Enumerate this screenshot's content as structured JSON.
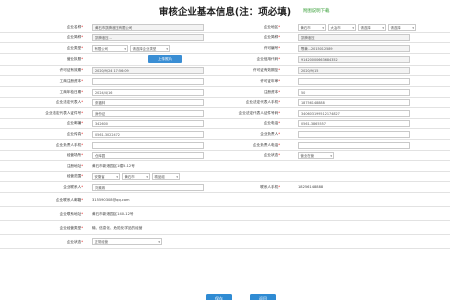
{
  "title": "审核企业基本信息(注：项必填)",
  "title_hint": "附图说明下载",
  "colors": {
    "accent": "#3a8ed4",
    "required": "#e02020",
    "hint": "#2f9a2f"
  },
  "rows": [
    {
      "left_label": "企业名称",
      "left_req": "*",
      "left_value": "黄石市凯腾液压有限公司",
      "right_label": "企业地区",
      "right_req": "*",
      "right_selects": [
        "黄石市",
        "大冶市",
        "请选择",
        "请选择"
      ]
    },
    {
      "left_label": "企业简称",
      "left_req": "*",
      "left_value": "凯腾液压...",
      "right_label": "企业简称",
      "right_req": "*",
      "right_value": "凯腾液压"
    },
    {
      "left_label": "企业类型",
      "left_req": "*",
      "left_selects": [
        "有限公司",
        "请选择企业类型"
      ],
      "right_label": "许可编号",
      "right_req": "*",
      "right_value": "鄂黄...2015012589"
    },
    {
      "left_label": "营业执照",
      "left_req": "*",
      "left_button": "上传照片",
      "right_label": "企业信用代码",
      "right_req": "*",
      "right_value": "91420000663684352"
    },
    {
      "left_label": "许可证有效期",
      "left_req": "*",
      "left_value": "2020/9/24 17:56:09",
      "right_label": "许可证有效期至",
      "right_req": "*",
      "right_value": "2020/9/15"
    },
    {
      "left_label": "工商注册资本",
      "left_req": "*",
      "left_value": "",
      "right_label": "许可证年审",
      "right_req": "*",
      "right_value": ""
    },
    {
      "left_label": "工商年检日期",
      "left_req": "*",
      "left_value": "2024/4/16",
      "right_label": "注册资本",
      "right_req": "*",
      "right_value": "50"
    },
    {
      "left_label": "企业法定代表人",
      "left_req": "*",
      "left_value": "张福林",
      "right_label": "企业法定代表人手机",
      "right_req": "*",
      "right_value": "18756148888"
    },
    {
      "left_label": "企业法定代表人证件号",
      "left_req": "*",
      "left_value": "身份证",
      "right_label": "企业法定代表人证件号码",
      "right_req": "*",
      "right_value": "340603199512174827"
    },
    {
      "left_label": "企业邮编",
      "left_req": "*",
      "left_value": "342600",
      "right_label": "企业电话",
      "right_req": "*",
      "right_value": "0561-3865557"
    },
    {
      "left_label": "企业传真",
      "left_req": "*",
      "left_value": "0561-3022472",
      "right_label": "企业负责人",
      "right_req": "*",
      "right_value": ""
    },
    {
      "left_label": "企业负责人手机",
      "left_req": "*",
      "left_value": "",
      "right_label": "企业负责人电话",
      "right_req": "*",
      "right_value": ""
    },
    {
      "left_label": "经营场所",
      "left_req": "*",
      "left_value": "仓库园",
      "right_label": "企业状态",
      "right_req": "*",
      "right_select": "营业在营"
    }
  ],
  "full_rows": [
    {
      "label": "注册地址",
      "req": "*",
      "value": "黄石市新港园区1幢5-12号"
    },
    {
      "label": "经营范围",
      "req": "*",
      "selects": [
        "安徽省",
        "黄石市",
        "精品组"
      ]
    }
  ],
  "contact_row": {
    "left_label": "企业联系人",
    "left_req": "*",
    "left_value": "刘素珠",
    "right_label": "联系人手机",
    "right_req": "*",
    "right_value": "18256148888"
  },
  "bottom_rows": [
    {
      "label": "企业联系人邮箱",
      "req": "*",
      "value": "315590308@qq.com"
    },
    {
      "label": "企业联系地址",
      "req": "*",
      "value": "黄石市新港园区140-12号"
    },
    {
      "label": "企业经营类型",
      "req": "*",
      "value": "输、信息化、危险化学品的经营"
    },
    {
      "label": "企业状态",
      "req": "*",
      "select": "正常经营"
    }
  ],
  "buttons": {
    "save": "保存",
    "cancel": "返回"
  }
}
